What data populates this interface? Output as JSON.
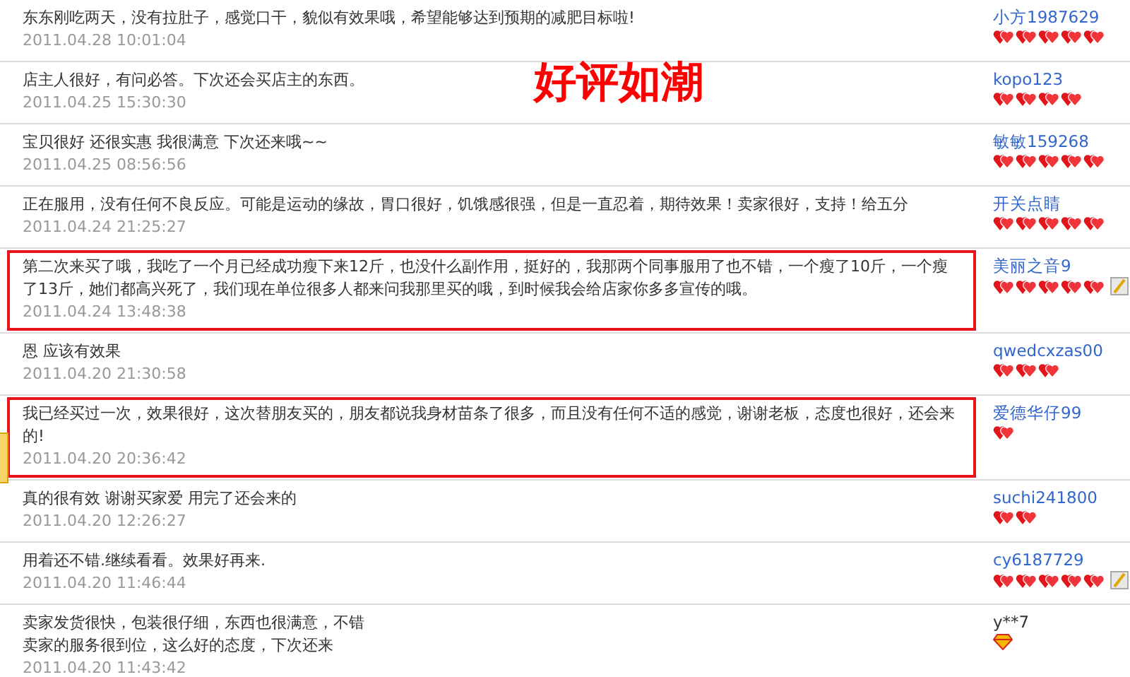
{
  "headline": "好评如潮",
  "reviews": [
    {
      "lines": [
        "东东刚吃两天，没有拉肚子，感觉口干，貌似有效果哦，希望能够达到预期的减肥目标啦!"
      ],
      "time": "2011.04.28 10:01:04",
      "user": "小方1987629",
      "user_link": true,
      "badges": [
        {
          "kind": "heart"
        },
        {
          "kind": "heart"
        },
        {
          "kind": "heart"
        },
        {
          "kind": "heart"
        },
        {
          "kind": "heart"
        }
      ],
      "highlighted": false
    },
    {
      "lines": [
        "店主人很好，有问必答。下次还会买店主的东西。"
      ],
      "time": "2011.04.25 15:30:30",
      "user": "kopo123",
      "user_link": true,
      "badges": [
        {
          "kind": "heart"
        },
        {
          "kind": "heart"
        },
        {
          "kind": "heart"
        },
        {
          "kind": "heart"
        }
      ],
      "highlighted": false
    },
    {
      "lines": [
        "宝贝很好 还很实惠 我很满意 下次还来哦~~"
      ],
      "time": "2011.04.25 08:56:56",
      "user": "敏敏159268",
      "user_link": true,
      "badges": [
        {
          "kind": "heart"
        },
        {
          "kind": "heart"
        },
        {
          "kind": "heart"
        },
        {
          "kind": "heart"
        },
        {
          "kind": "heart"
        }
      ],
      "highlighted": false
    },
    {
      "lines": [
        "正在服用，没有任何不良反应。可能是运动的缘故，胃口很好，饥饿感很强，但是一直忍着，期待效果！卖家很好，支持！给五分"
      ],
      "time": "2011.04.24 21:25:27",
      "user": "开关点睛",
      "user_link": true,
      "badges": [
        {
          "kind": "heart"
        },
        {
          "kind": "heart"
        },
        {
          "kind": "heart"
        },
        {
          "kind": "heart"
        },
        {
          "kind": "heart"
        }
      ],
      "highlighted": false
    },
    {
      "lines": [
        "第二次来买了哦，我吃了一个月已经成功瘦下来12斤，也没什么副作用，挺好的，我那两个同事服用了也不错，一个瘦了10斤，一个瘦了13斤，她们都高兴死了，我们现在单位很多人都来问我那里买的哦，到时候我会给店家你多多宣传的哦。"
      ],
      "time": "2011.04.24 13:48:38",
      "user": "美丽之音9",
      "user_link": true,
      "badges": [
        {
          "kind": "heart"
        },
        {
          "kind": "heart"
        },
        {
          "kind": "heart"
        },
        {
          "kind": "heart"
        },
        {
          "kind": "heart"
        },
        {
          "kind": "vip"
        }
      ],
      "highlighted": true
    },
    {
      "lines": [
        "恩 应该有效果"
      ],
      "time": "2011.04.20 21:30:58",
      "user": "qwedcxzas00",
      "user_link": true,
      "badges": [
        {
          "kind": "heart"
        },
        {
          "kind": "heart"
        },
        {
          "kind": "heart"
        }
      ],
      "highlighted": false
    },
    {
      "lines": [
        "我已经买过一次，效果很好，这次替朋友买的，朋友都说我身材苗条了很多，而且没有任何不适的感觉，谢谢老板，态度也很好，还会来的!"
      ],
      "time": "2011.04.20 20:36:42",
      "user": "爱德华仔99",
      "user_link": true,
      "badges": [
        {
          "kind": "heart"
        }
      ],
      "highlighted": true
    },
    {
      "lines": [
        "真的很有效 谢谢买家爱 用完了还会来的"
      ],
      "time": "2011.04.20 12:26:27",
      "user": "suchi241800",
      "user_link": true,
      "badges": [
        {
          "kind": "heart"
        },
        {
          "kind": "heart"
        }
      ],
      "highlighted": false
    },
    {
      "lines": [
        "用着还不错.继续看看。效果好再来."
      ],
      "time": "2011.04.20 11:46:44",
      "user": "cy6187729",
      "user_link": true,
      "badges": [
        {
          "kind": "heart"
        },
        {
          "kind": "heart"
        },
        {
          "kind": "heart"
        },
        {
          "kind": "heart"
        },
        {
          "kind": "heart"
        },
        {
          "kind": "vip"
        }
      ],
      "highlighted": false
    },
    {
      "lines": [
        "卖家发货很快，包装很仔细，东西也很满意，不错",
        "卖家的服务很到位，这么好的态度，下次还来"
      ],
      "time": "2011.04.20 11:43:42",
      "user": "y**7",
      "user_link": false,
      "badges": [
        {
          "kind": "diamond"
        }
      ],
      "highlighted": false
    }
  ]
}
